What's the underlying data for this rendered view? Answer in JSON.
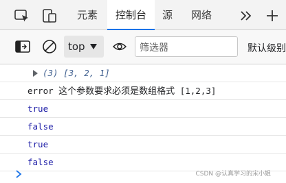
{
  "tabs": [
    {
      "label": "元素"
    },
    {
      "label": "控制台"
    },
    {
      "label": "源"
    },
    {
      "label": "网络"
    }
  ],
  "toolbar": {
    "context_label": "top",
    "filter_placeholder": "筛选器",
    "levels_label": "默认级别"
  },
  "console": {
    "array_summary": "(3) [3, 2, 1]",
    "error_prefix": "error",
    "error_message": "这个参数要求必须是数组格式",
    "error_value": "[1,2,3]",
    "results": [
      "true",
      "false",
      "true",
      "false"
    ]
  },
  "watermark": "CSDN @认真学习的宋小姐"
}
